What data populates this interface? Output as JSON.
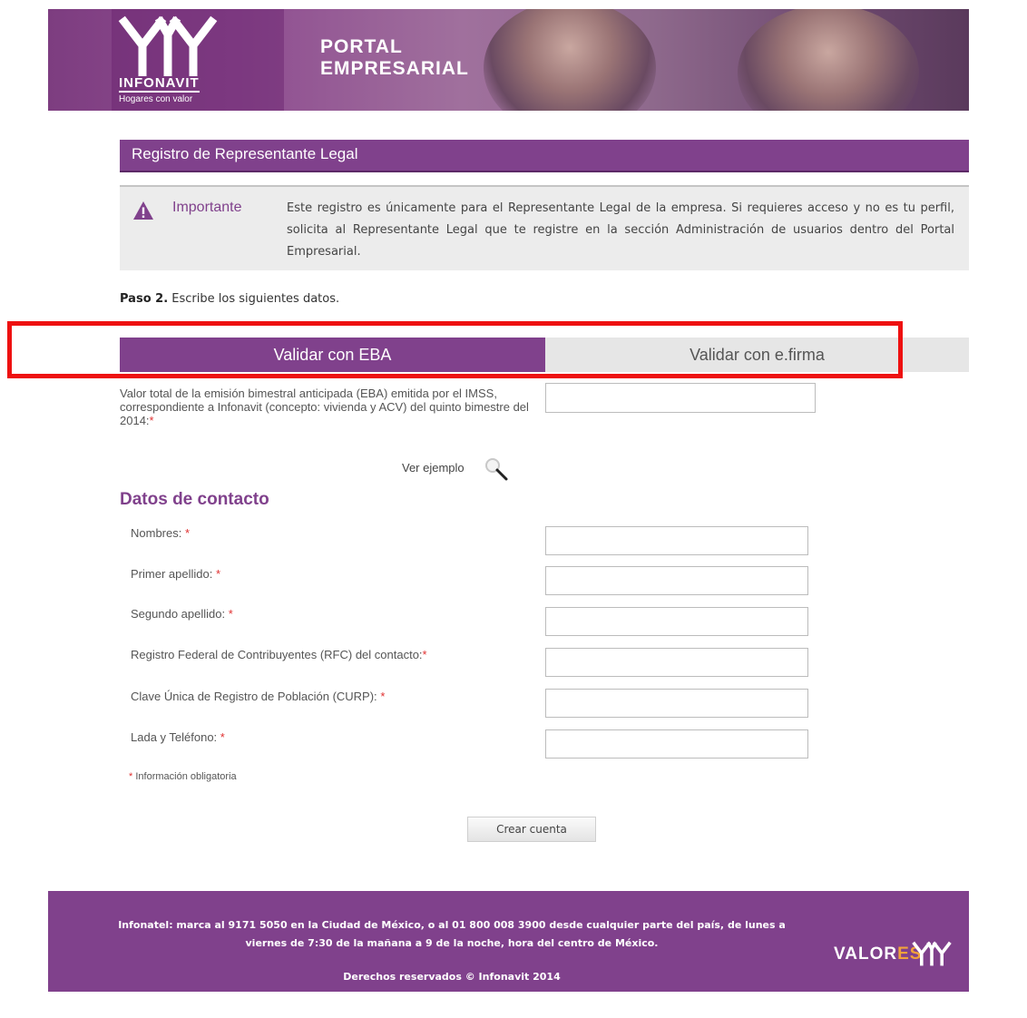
{
  "banner": {
    "logo_text": "INFONAVIT",
    "logo_tagline": "Hogares con valor",
    "portal_line1": "PORTAL",
    "portal_line2": "EMPRESARIAL"
  },
  "section": {
    "title": "Registro de Representante Legal"
  },
  "important": {
    "label": "Importante",
    "text": "Este registro es únicamente para el Representante Legal de la empresa. Si requieres acceso y no es tu perfil, solicita al Representante Legal que te registre en la sección Administración de usuarios dentro del Portal Empresarial."
  },
  "step": {
    "bold": "Paso 2.",
    "text": "Escribe los siguientes datos."
  },
  "tabs": [
    {
      "label": "Validar con EBA",
      "active": true
    },
    {
      "label": "Validar con e.firma",
      "active": false
    }
  ],
  "eba": {
    "label": "Valor total de la emisión bimestral anticipada (EBA) emitida por el IMSS, correspondiente a Infonavit (concepto: vivienda y ACV) del quinto bimestre del 2014:",
    "value": "",
    "example_link": "Ver ejemplo"
  },
  "contact": {
    "title": "Datos de contacto",
    "fields": [
      {
        "label": "Nombres:",
        "value": ""
      },
      {
        "label": "Primer apellido:",
        "value": ""
      },
      {
        "label": "Segundo apellido:",
        "value": ""
      },
      {
        "label": "Registro Federal de Contribuyentes (RFC) del contacto:",
        "value": ""
      },
      {
        "label": "Clave Única de Registro de Población (CURP):",
        "value": ""
      },
      {
        "label": "Lada y Teléfono:",
        "value": ""
      }
    ],
    "required_mark": "*",
    "required_note": "Información obligatoria",
    "submit_label": "Crear cuenta"
  },
  "footer": {
    "line1": "Infonatel: marca al 9171 5050 en la Ciudad de México, o al 01 800 008 3900 desde cualquier parte del país, de lunes a",
    "line2": "viernes de 7:30 de la mañana a 9 de la noche, hora del centro de México.",
    "copyright": "Derechos reservados © Infonavit 2014",
    "valores_a": "VALOR",
    "valores_b": "ES"
  },
  "colors": {
    "brand_purple": "#80418c",
    "accent_orange": "#f2a23a",
    "highlight_red": "#ee1111",
    "required_red": "#e03030"
  }
}
